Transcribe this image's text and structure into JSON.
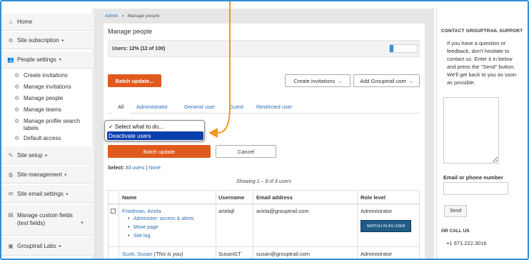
{
  "sidebar": {
    "home": "Home",
    "site_subscription": "Site subscription",
    "people_settings": "People settings",
    "sub_items": [
      "Create invitations",
      "Manage invitations",
      "Manage people",
      "Manage teams",
      "Manage profile search labels",
      "Default access"
    ],
    "site_setup": "Site setup",
    "site_management": "Site management",
    "site_email_settings": "Site email settings",
    "manage_custom_fields": "Manage custom fields (text fields)",
    "grouptrail_labs": "Grouptrail Labs"
  },
  "breadcrumb": {
    "admin": "Admin",
    "sep": "»",
    "current": "Manage people"
  },
  "page_title": "Manage people",
  "usage": {
    "label": "Users: 12% (12 of 100)",
    "fraction": 0.12
  },
  "buttons": {
    "batch_update_top": "Batch update...",
    "create_invitations": "Create invitations →",
    "add_user": "Add Grouptrail user →",
    "batch_update": "Batch update",
    "cancel": "Cancel"
  },
  "tabs": [
    "All",
    "Administrator",
    "General user",
    "Guest",
    "Restricted user"
  ],
  "dropdown": {
    "options": [
      "✓ Select what to do...",
      "Deactivate users"
    ],
    "selected_index": 1
  },
  "select_line": {
    "label": "Select:",
    "all": "All users",
    "sep": "|",
    "none": "None"
  },
  "showing": "Showing 1 – 8 of 8 users",
  "table": {
    "headers": [
      "Name",
      "Username",
      "Email address",
      "Role level"
    ],
    "rows": [
      {
        "name": "Friedman, Ariela",
        "username": "arielajf",
        "email": "ariela@grouptrail.com",
        "role": "Administrator",
        "links": [
          "Administer: access & alerts",
          "Move page",
          "Site log"
        ],
        "action": "SWITCH IN AS USER"
      },
      {
        "name": "Scott, Susan",
        "note": "(This is you)",
        "username": "SusanGT",
        "email": "susan@grouptrail.com",
        "role": "Administrator"
      }
    ]
  },
  "support": {
    "title": "CONTACT GROUPTRAIL SUPPORT",
    "text": "If you have a question or feedback, don't hesitate to contact us. Enter it in below and press the \"Send\" button. We'll get back to you as soon as possible.",
    "email_label": "Email or phone number",
    "send": "Send",
    "or_call": "OR CALL US",
    "phone": "+1 971.222.3016"
  },
  "colors": {
    "accent_orange": "#e05a1e",
    "link_blue": "#2a6fb4",
    "frame_blue": "#2f8fd8",
    "dropdown_highlight": "#0a3fae",
    "annotation_arrow": "#f7941d"
  },
  "icons": {
    "home": "home-icon",
    "site_subscription": "subscription-icon",
    "people_settings": "people-icon",
    "sub_item": "gear-icon",
    "site_setup": "wrench-icon",
    "site_management": "globe-icon",
    "site_email_settings": "envelope-icon",
    "manage_custom_fields": "document-icon",
    "grouptrail_labs": "labs-icon"
  }
}
